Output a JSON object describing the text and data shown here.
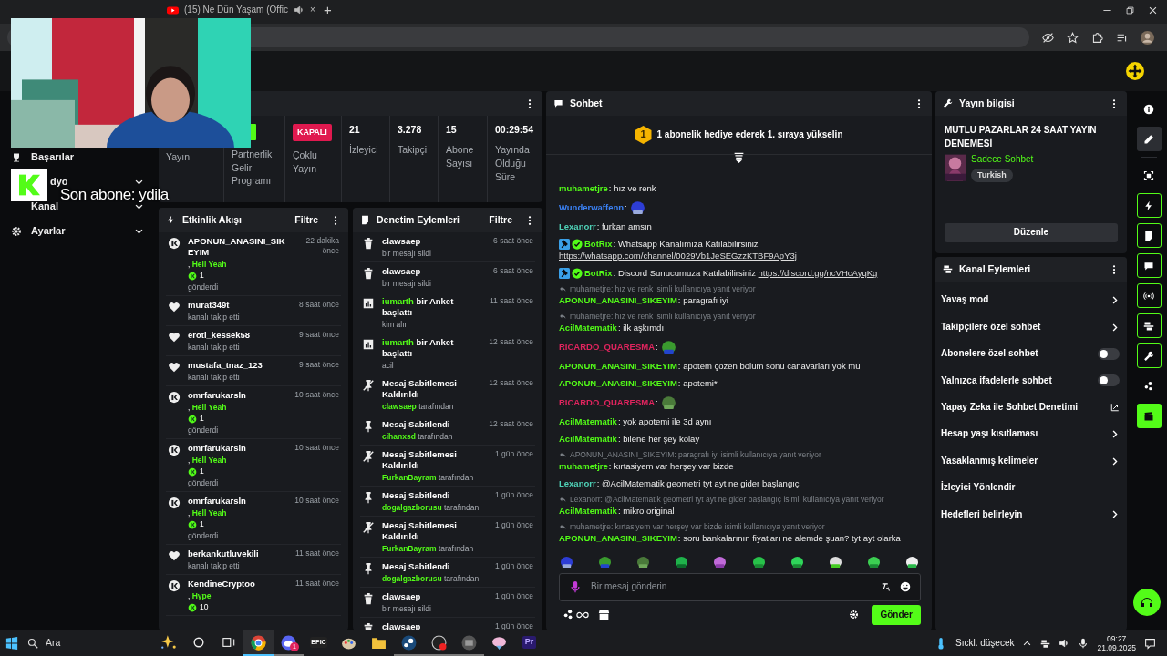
{
  "browser": {
    "tabs": [
      {
        "title": "(15) Ne Dün Yaşam (Offic",
        "selected": false,
        "audio": true,
        "close": "×"
      }
    ],
    "new_tab": "+"
  },
  "stream_overlay": {
    "text": "Son abone: ydila"
  },
  "sidebar": {
    "items": [
      {
        "label": "Başarılar",
        "expandable": false
      },
      {
        "label": "dyo",
        "expandable": true
      },
      {
        "label": "Kanal",
        "expandable": true
      },
      {
        "label": "Ayarlar",
        "expandable": true
      }
    ]
  },
  "stats": {
    "items": [
      {
        "kind": "text",
        "label": "Yayın"
      },
      {
        "kind": "icon",
        "label": "Partnerlik Gelir Programı"
      },
      {
        "kind": "badge",
        "value": "KAPALI",
        "label": "Çoklu Yayın"
      },
      {
        "kind": "number",
        "value": "21",
        "label": "İzleyici"
      },
      {
        "kind": "number",
        "value": "3.278",
        "label": "Takipçi"
      },
      {
        "kind": "number",
        "value": "15",
        "label": "Abone Sayısı"
      },
      {
        "kind": "number",
        "value": "00:29:54",
        "label": "Yayında Olduğu Süre"
      }
    ]
  },
  "activity": {
    "title": "Etkinlik Akışı",
    "filter": "Filtre",
    "items": [
      {
        "kind": "gift",
        "user": "APONUN_ANASINI_SIKEYIM",
        "time": "22 dakika önce",
        "gift": ", **Hell Yeah**",
        "count": "1",
        "verb": "gönderdi"
      },
      {
        "kind": "follow",
        "user": "murat349t",
        "time": "8 saat önce",
        "verb": "kanalı takip etti"
      },
      {
        "kind": "follow",
        "user": "eroti_kessek58",
        "time": "9 saat önce",
        "verb": "kanalı takip etti"
      },
      {
        "kind": "follow",
        "user": "mustafa_tnaz_123",
        "time": "9 saat önce",
        "verb": "kanalı takip etti"
      },
      {
        "kind": "gift",
        "user": "omrfarukarsln",
        "time": "10 saat önce",
        "gift": ", **Hell Yeah**",
        "count": "1",
        "verb": "gönderdi"
      },
      {
        "kind": "gift",
        "user": "omrfarukarsln",
        "time": "10 saat önce",
        "gift": ", **Hell Yeah**",
        "count": "1",
        "verb": "gönderdi"
      },
      {
        "kind": "gift",
        "user": "omrfarukarsln",
        "time": "10 saat önce",
        "gift": ", **Hell Yeah**",
        "count": "1",
        "verb": "gönderdi"
      },
      {
        "kind": "follow",
        "user": "berkankutluvekili",
        "time": "11 saat önce",
        "verb": "kanalı takip etti"
      },
      {
        "kind": "gift",
        "user": "KendineCryptoo",
        "time": "11 saat önce",
        "gift": ", **Hype**",
        "count": "10"
      }
    ]
  },
  "moderation": {
    "title": "Denetim Eylemleri",
    "filter": "Filtre",
    "items": [
      {
        "kind": "delete",
        "title": "clawsaep",
        "time": "6 saat önce",
        "detail": "bir mesajı sildi"
      },
      {
        "kind": "delete",
        "title": "clawsaep",
        "time": "6 saat önce",
        "detail": "bir mesajı sildi"
      },
      {
        "kind": "poll",
        "title": "**iumarth** bir Anket başlattı",
        "time": "11 saat önce",
        "detail": "kim alır"
      },
      {
        "kind": "poll",
        "title": "**iumarth** bir Anket başlattı",
        "time": "12 saat önce",
        "detail": "acil"
      },
      {
        "kind": "unpin",
        "title": "Mesaj Sabitlemesi Kaldırıldı",
        "time": "12 saat önce",
        "detail": "**clawsaep** tarafından"
      },
      {
        "kind": "pin",
        "title": "Mesaj Sabitlendi",
        "time": "12 saat önce",
        "detail": "**cihanxsd** tarafından"
      },
      {
        "kind": "unpin",
        "title": "Mesaj Sabitlemesi Kaldırıldı",
        "time": "1 gün önce",
        "detail": "**FurkanBayram** tarafından"
      },
      {
        "kind": "pin",
        "title": "Mesaj Sabitlendi",
        "time": "1 gün önce",
        "detail": "**dogalgazborusu** tarafından"
      },
      {
        "kind": "unpin",
        "title": "Mesaj Sabitlemesi Kaldırıldı",
        "time": "1 gün önce",
        "detail": "**FurkanBayram** tarafından"
      },
      {
        "kind": "pin",
        "title": "Mesaj Sabitlendi",
        "time": "1 gün önce",
        "detail": "**dogalgazborusu** tarafından"
      },
      {
        "kind": "delete",
        "title": "clawsaep",
        "time": "1 gün önce",
        "detail": "bir mesajı sildi"
      },
      {
        "kind": "delete",
        "title": "clawsaep",
        "time": "1 gün önce"
      }
    ]
  },
  "chat": {
    "title": "Sohbet",
    "pinned": {
      "rank": "1",
      "text": "1 abonelik hediye ederek 1. sıraya yükselin"
    },
    "messages": [
      {
        "user": "muhametjre",
        "color": "#53fc18",
        "text": ": hız ve renk"
      },
      {
        "user": "Wunderwaffenn",
        "color": "#3b82f6",
        "text": ":",
        "emote": true
      },
      {
        "user": "Lexanorr",
        "color": "#4fd1b7",
        "text": ": furkan amsın"
      },
      {
        "user": "BotRix",
        "color": "#53fc18",
        "bot": true,
        "text": ": Whatsapp Kanalımıza Katılabilirsiniz",
        "link": "https://whatsapp.com/channel/0029Vb1JeSEGzzKTBF9ApY3j"
      },
      {
        "user": "BotRix",
        "color": "#53fc18",
        "bot": true,
        "text": ": Discord Sunucumuza Katılabilirsiniz",
        "link": "https://discord.gg/ncVHcAyqKg"
      },
      {
        "reply": "muhametjre: hız ve renk isimli kullanıcıya yanıt veriyor",
        "user": "APONUN_ANASINI_SIKEYIM",
        "color": "#53fc18",
        "text": ": paragrafı iyi"
      },
      {
        "reply": "muhametjre: hız ve renk isimli kullanıcıya yanıt veriyor",
        "user": "AcilMatematik",
        "color": "#53fc18",
        "text": ": ilk aşkımdı"
      },
      {
        "user": "RICARDO_QUARESMA",
        "color": "#e0245e",
        "text": ":",
        "emote": true
      },
      {
        "user": "APONUN_ANASINI_SIKEYIM",
        "color": "#53fc18",
        "text": ": apotem çözen bölüm sonu canavarları yok mu"
      },
      {
        "user": "APONUN_ANASINI_SIKEYIM",
        "color": "#53fc18",
        "text": ": apotemi*"
      },
      {
        "user": "RICARDO_QUARESMA",
        "color": "#e0245e",
        "text": ":",
        "emote": true
      },
      {
        "user": "AcilMatematik",
        "color": "#53fc18",
        "text": ": yok apotemi ile 3d aynı"
      },
      {
        "user": "AcilMatematik",
        "color": "#53fc18",
        "text": ": bilene her şey kolay"
      },
      {
        "reply": "APONUN_ANASINI_SIKEYIM: paragrafı iyi isimli kullanıcıya yanıt veriyor",
        "user": "muhametjre",
        "color": "#53fc18",
        "text": ": kırtasiyem var herşey var bizde"
      },
      {
        "user": "Lexanorr",
        "color": "#4fd1b7",
        "text": ": @AcilMatematik geometri tyt ayt ne gider başlangıç"
      },
      {
        "reply": "Lexanorr: @AcilMatematik geometri tyt ayt ne gider başlangıç isimli kullanıcıya yanıt veriyor",
        "user": "AcilMatematik",
        "color": "#53fc18",
        "text": ": mikro original"
      },
      {
        "reply": "muhametjre: kırtasiyem var herşey var bizde isimli kullanıcıya yanıt veriyor",
        "user": "APONUN_ANASINI_SIKEYIM",
        "color": "#53fc18",
        "text": ": soru bankalarının fiyatları ne alemde şuan? tyt ayt olarka"
      }
    ],
    "placeholder": "Bir mesaj gönderin",
    "send": "Gönder"
  },
  "stream_info": {
    "title": "Yayın bilgisi",
    "stream_title": "MUTLU PAZARLAR 24 SAAT YAYIN DENEMESİ",
    "category": "Sadece Sohbet",
    "tag": "Turkish",
    "edit": "Düzenle"
  },
  "channel_actions": {
    "title": "Kanal Eylemleri",
    "items": [
      {
        "label": "Yavaş mod",
        "kind": "nav"
      },
      {
        "label": "Takipçilere özel sohbet",
        "kind": "nav"
      },
      {
        "label": "Abonelere özel sohbet",
        "kind": "toggle",
        "on": false
      },
      {
        "label": "Yalnızca ifadelerle sohbet",
        "kind": "toggle",
        "on": false
      },
      {
        "label": "Yapay Zeka ile Sohbet Denetimi",
        "kind": "external"
      },
      {
        "label": "Hesap yaşı kısıtlaması",
        "kind": "nav"
      },
      {
        "label": "Yasaklanmış kelimeler",
        "kind": "nav"
      },
      {
        "label": "İzleyici Yönlendir",
        "kind": "plain"
      },
      {
        "label": "Hedefleri belirleyin",
        "kind": "nav"
      }
    ]
  },
  "rail": [
    {
      "selected": false,
      "on": false
    },
    {
      "selected": true,
      "on": false
    },
    {
      "selected": false,
      "on": false
    },
    {
      "selected": false,
      "on": true
    },
    {
      "selected": false,
      "on": true
    },
    {
      "selected": false,
      "on": true
    },
    {
      "selected": false,
      "on": true
    },
    {
      "selected": false,
      "on": true
    },
    {
      "selected": false,
      "on": true
    },
    {
      "selected": false,
      "on": false
    },
    {
      "on": false,
      "active": true
    }
  ],
  "taskbar": {
    "search": "Ara",
    "apps": [
      {
        "running": false,
        "selected": false
      },
      {
        "running": false,
        "selected": false
      },
      {
        "running": false,
        "selected": false
      },
      {
        "running": true,
        "selected": true
      },
      {
        "running": true,
        "selected": false,
        "badge": "1"
      },
      {
        "running": false,
        "selected": false,
        "label": "EPIC"
      },
      {
        "running": false,
        "selected": false
      },
      {
        "running": false,
        "selected": false
      },
      {
        "running": true,
        "selected": false
      },
      {
        "running": true,
        "selected": false
      },
      {
        "running": true,
        "selected": false
      },
      {
        "running": false,
        "selected": false
      },
      {
        "running": false,
        "selected": false,
        "label": "Pr"
      }
    ],
    "weather": "Sıckl. düşecek",
    "time": "09:27",
    "date": "21.09.2025"
  }
}
